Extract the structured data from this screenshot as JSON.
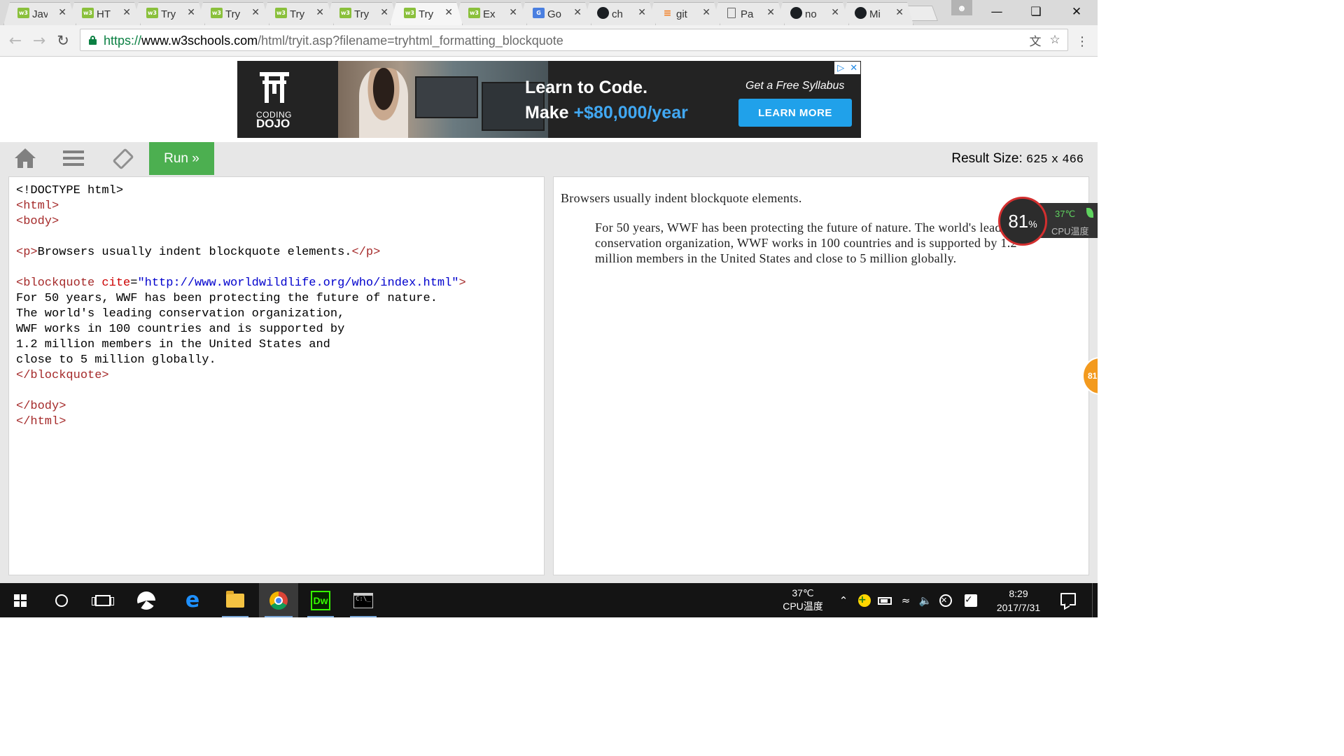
{
  "browser": {
    "tabs": [
      {
        "favicon": "w3schools-icon",
        "title": "Jav"
      },
      {
        "favicon": "w3schools-icon",
        "title": "HT"
      },
      {
        "favicon": "w3schools-icon",
        "title": "Try"
      },
      {
        "favicon": "w3schools-icon",
        "title": "Try"
      },
      {
        "favicon": "w3schools-icon",
        "title": "Try"
      },
      {
        "favicon": "w3schools-icon",
        "title": "Try"
      },
      {
        "favicon": "w3schools-icon",
        "title": "Try",
        "active": true
      },
      {
        "favicon": "w3schools-icon",
        "title": "Ex"
      },
      {
        "favicon": "google-translate-icon",
        "title": "Go"
      },
      {
        "favicon": "github-icon",
        "title": "ch"
      },
      {
        "favicon": "stackoverflow-icon",
        "title": "git"
      },
      {
        "favicon": "document-icon",
        "title": "Pa"
      },
      {
        "favicon": "github-icon",
        "title": "no"
      },
      {
        "favicon": "github-icon",
        "title": "Mi"
      }
    ],
    "url_scheme": "https://",
    "url_host": "www.w3schools.com",
    "url_path": "/html/tryit.asp?filename=tryhtml_formatting_blockquote"
  },
  "ad": {
    "brand_line1": "CODING",
    "brand_line2": "DOJO",
    "headline1": "Learn to Code.",
    "headline2_prefix": "Make ",
    "headline2_money": "+$80,000/year",
    "syllabus": "Get a Free Syllabus",
    "cta": "LEARN MORE"
  },
  "tryit": {
    "run_label": "Run »",
    "result_size_label": "Result Size:",
    "result_width": "625",
    "result_x": "x",
    "result_height": "466"
  },
  "code_lines": [
    "<!DOCTYPE html>",
    "<html>",
    "<body>",
    "",
    "<p>Browsers usually indent blockquote elements.</p>",
    "",
    "<blockquote cite=\"http://www.worldwildlife.org/who/index.html\">",
    "For 50 years, WWF has been protecting the future of nature.",
    "The world's leading conservation organization,",
    "WWF works in 100 countries and is supported by",
    "1.2 million members in the United States and",
    "close to 5 million globally.",
    "</blockquote>",
    "",
    "</body>",
    "</html>"
  ],
  "result": {
    "paragraph": "Browsers usually indent blockquote elements.",
    "blockquote": "For 50 years, WWF has been protecting the future of nature. The world's leading conservation organization, WWF works in 100 countries and is supported by 1.2 million members in the United States and close to 5 million globally."
  },
  "cpu_widget": {
    "percent": "81",
    "percent_sign": "%",
    "temperature": "37℃",
    "label": "CPU温度",
    "badge": "81"
  },
  "taskbar": {
    "tray_temperature": "37℃",
    "tray_label": "CPU温度",
    "time": "8:29",
    "date": "2017/7/31"
  }
}
